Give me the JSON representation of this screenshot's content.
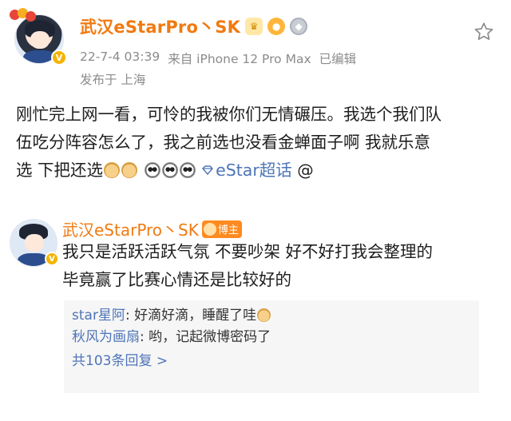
{
  "post": {
    "author": "武汉eStarPro丶SK",
    "time": "22-7-4 03:39",
    "source": "来自 iPhone 12 Pro Max",
    "edited": "已编辑",
    "location": "发布于 上海",
    "text_line1": "刚忙完上网一看，可怜的我被你们无情碾压。我选个我们队",
    "text_line2": "伍吃分阵容怎么了，我之前选也没看金蝉面子啊 我就乐意",
    "text_line3": "选 下把还选",
    "topic": "eStar超话",
    "mention": "@"
  },
  "comment": {
    "author": "武汉eStarPro丶SK",
    "host_badge": "博主",
    "text_line1": "我只是活跃活跃气氛 不要吵架 好不好打我会整理的",
    "text_line2": "毕竟赢了比赛心情还是比较好的",
    "replies": [
      {
        "user": "star星阿",
        "text": ": 好滴好滴，睡醒了哇"
      },
      {
        "user": "秋风为画扇",
        "text": ": 哟，记起微博密码了"
      }
    ],
    "more_replies": "共103条回复 >"
  },
  "icons": {
    "favorite": "star-outline-icon",
    "verified": "vip-badge-icon"
  },
  "colors": {
    "username": "#f07a11",
    "link": "#4e74b8",
    "meta": "#8b8b8b"
  }
}
